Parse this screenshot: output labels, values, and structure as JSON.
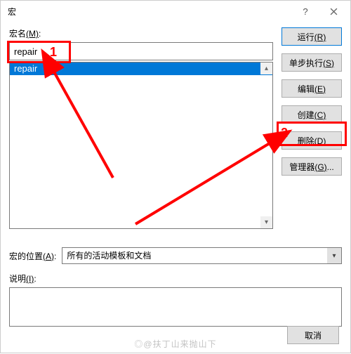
{
  "window": {
    "title": "宏"
  },
  "labels": {
    "macro_name": "宏名",
    "macro_name_hotkey": "(M)",
    "macro_location": "宏的位置",
    "macro_location_hotkey": "(A)",
    "description": "说明",
    "description_hotkey": "(I)"
  },
  "fields": {
    "macro_name_value": "repair",
    "macro_location_value": "所有的活动模板和文档"
  },
  "list": {
    "items": [
      {
        "name": "repair",
        "selected": true
      }
    ]
  },
  "buttons": {
    "run": "运行",
    "run_hotkey": "(R)",
    "step": "单步执行",
    "step_hotkey": "(S)",
    "edit": "编辑",
    "edit_hotkey": "(E)",
    "create": "创建",
    "create_hotkey": "(C)",
    "delete": "删除",
    "delete_hotkey": "(D)",
    "organizer": "管理器",
    "organizer_hotkey": "(G)",
    "cancel": "取消"
  },
  "annotations": {
    "one": "1",
    "two": "2"
  },
  "watermark": "◎@扶丁山来抛山下"
}
